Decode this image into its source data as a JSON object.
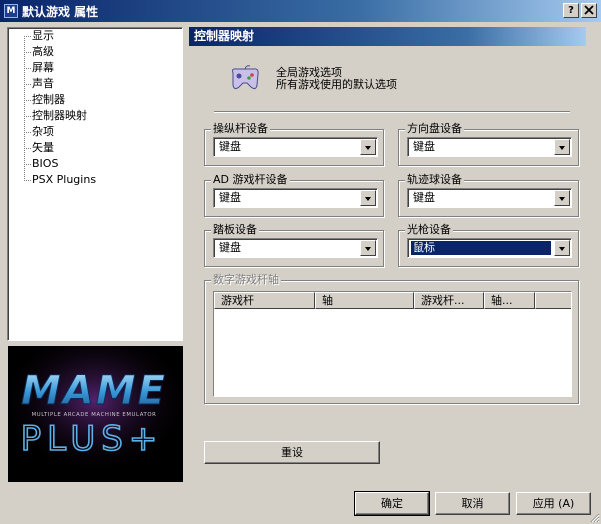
{
  "window": {
    "title": "默认游戏 属性",
    "app_icon": "mame-icon",
    "help_button": "?",
    "close_button": "X"
  },
  "tree": {
    "items": [
      "显示",
      "高级",
      "屏幕",
      "声音",
      "控制器",
      "控制器映射",
      "杂项",
      "矢量",
      "BIOS",
      "PSX Plugins"
    ],
    "selected": "控制器映射"
  },
  "logo": {
    "line1": "MAME",
    "tagline": "MULTIPLE ARCADE MACHINE EMULATOR",
    "line2": "PLUS+"
  },
  "page": {
    "header": "控制器映射",
    "info_line1": "全局游戏选项",
    "info_line2": "所有游戏使用的默认选项",
    "info_icon": "gamepad-icon"
  },
  "groups": {
    "joystick": {
      "label": "操纵杆设备",
      "value": "键盘"
    },
    "dpad": {
      "label": "方向盘设备",
      "value": "键盘"
    },
    "ad_joystick": {
      "label": "AD 游戏杆设备",
      "value": "键盘"
    },
    "trackball": {
      "label": "轨迹球设备",
      "value": "键盘"
    },
    "pedal": {
      "label": "踏板设备",
      "value": "键盘"
    },
    "lightgun": {
      "label": "光枪设备",
      "value": "鼠标"
    }
  },
  "digital_axis": {
    "label": "数字游戏杆轴",
    "columns": [
      "游戏杆",
      "轴",
      "游戏杆...",
      "轴..."
    ]
  },
  "buttons": {
    "reset": "重设",
    "ok": "确定",
    "cancel": "取消",
    "apply": "应用 (A)"
  },
  "colors": {
    "titlebar_start": "#0a246a",
    "titlebar_end": "#a6caf0",
    "face": "#d4d0c8",
    "selection": "#0a246a"
  }
}
